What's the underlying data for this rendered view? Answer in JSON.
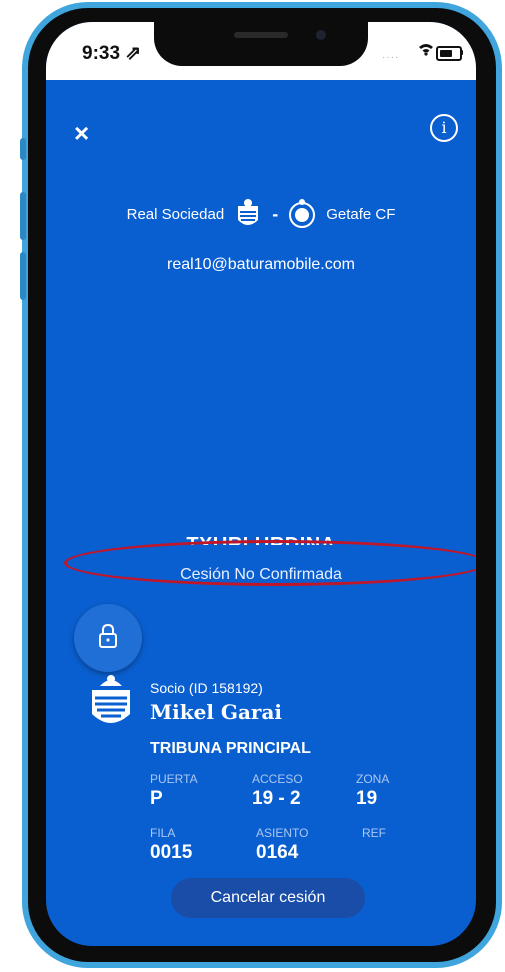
{
  "status_bar": {
    "time": "9:33 ⇗"
  },
  "header": {
    "close_icon": "×",
    "info_icon": "i"
  },
  "match": {
    "home_team": "Real Sociedad",
    "separator": "-",
    "away_team": "Getafe CF"
  },
  "user_email": "real10@baturamobile.com",
  "ticket": {
    "stand_name": "TXURI URDINA",
    "transfer_status": "Cesión No Confirmada",
    "member_line": "Socio (ID 158192)",
    "holder_name": "Mikel Garai",
    "section": "TRIBUNA PRINCIPAL",
    "fields": {
      "puerta_label": "PUERTA",
      "puerta_value": "P",
      "acceso_label": "ACCESO",
      "acceso_value": "19 - 2",
      "zona_label": "ZONA",
      "zona_value": "19",
      "fila_label": "FILA",
      "fila_value": "0015",
      "asiento_label": "ASIENTO",
      "asiento_value": "0164",
      "ref_label": "REF",
      "ref_value": ""
    }
  },
  "actions": {
    "cancel_label": "Cancelar cesión"
  },
  "colors": {
    "screen_bg": "#0a5fd0",
    "highlight": "#c0162a",
    "frame": "#3fa5dc"
  }
}
